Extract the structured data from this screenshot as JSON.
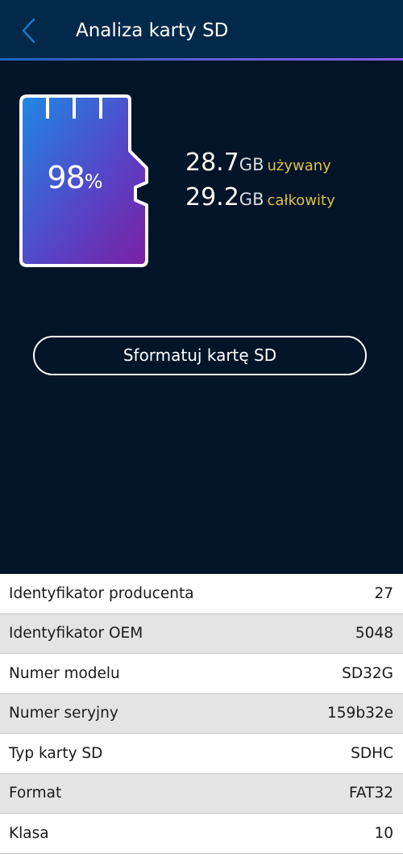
{
  "header": {
    "title": "Analiza karty SD",
    "back_icon": "chevron-left-icon"
  },
  "card": {
    "usage_percent": "98",
    "percent_sign": "%",
    "gradient_colors": [
      "#1e88e5",
      "#7b1fa2"
    ]
  },
  "storage": {
    "used_value": "28.7",
    "used_unit": "GB",
    "used_label": "używany",
    "total_value": "29.2",
    "total_unit": "GB",
    "total_label": "całkowity"
  },
  "format_button_label": "Sformatuj kartę SD",
  "info_rows": [
    {
      "label": "Identyfikator producenta",
      "value": "27"
    },
    {
      "label": "Identyfikator OEM",
      "value": "5048"
    },
    {
      "label": "Numer modelu",
      "value": "SD32G"
    },
    {
      "label": "Numer seryjny",
      "value": "159b32e"
    },
    {
      "label": "Typ karty SD",
      "value": "SDHC"
    },
    {
      "label": "Format",
      "value": "FAT32"
    },
    {
      "label": "Klasa",
      "value": "10"
    }
  ],
  "colors": {
    "background": "#011428",
    "header": "#03294a",
    "accent_label": "#e0c040",
    "back_icon": "#1f7fd4"
  }
}
